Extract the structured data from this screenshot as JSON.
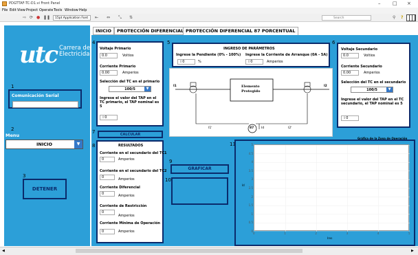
{
  "window": {
    "title": "PDGTTAF-TC-D1.vi Front Panel",
    "controls": [
      "–",
      "□",
      "×"
    ]
  },
  "menu": [
    "File",
    "Edit",
    "View",
    "Project",
    "Operate",
    "Tools",
    "Window",
    "Help"
  ],
  "toolbar": {
    "font": "15pt Application Font",
    "search_placeholder": "Search",
    "help": "?"
  },
  "sidebar": {
    "logo": "utc",
    "brand_line1": "Carrera de",
    "brand_line2": "Electricidad",
    "n1": "1",
    "serial_label": "Comunicación Serial",
    "n2": "2",
    "menu_label": "Menu",
    "menu_value": "INICIO",
    "n3": "3",
    "stop_label": "DETENER"
  },
  "tabs": [
    "INICIO",
    "PROTECCIÓN DIFERENCIAL 87",
    "PROTECCIÓN DIFERENCIAL 87 PORCENTUAL"
  ],
  "primary": {
    "n": "4",
    "voltage_label": "Voltaje Primario",
    "voltage_value": "0.0",
    "voltage_unit": "Voltios",
    "current_label": "Corriente Primario",
    "current_value": "0.00",
    "current_unit": "Amperios",
    "tc_label": "Selección del TC en el primario",
    "tc_value": "100/5",
    "tap_label": "Ingrese el valor del TAP en el TC primario, el TAP nominal es 5",
    "tap_value": "0"
  },
  "params": {
    "n": "5",
    "title": "INGRESO DE PARÁMETROS",
    "slope_label": "Ingrese la Pendiente (0% - 100%)",
    "slope_value": "0",
    "slope_unit": "%",
    "start_label": "Ingrese la Corriente de Arranque (0A - 5A)",
    "start_value": "0",
    "start_unit": "Amperios"
  },
  "diagram": {
    "element_line1": "Elemento",
    "element_line2": "Protegido",
    "i1": "I1",
    "i2": "I2",
    "i1p": "I1'",
    "i2p": "I2'",
    "relay": "87",
    "id": "Id"
  },
  "secondary": {
    "n": "6",
    "voltage_label": "Voltaje Secundario",
    "voltage_value": "0.0",
    "voltage_unit": "Voltios",
    "current_label": "Corriente Secundario",
    "current_value": "0.00",
    "current_unit": "Amperios",
    "tc_label": "Selección del TC en el secundario",
    "tc_value": "100/5",
    "tap_label": "Ingrese el valor del TAP en el TC secundario, el TAP nominal es 5",
    "tap_value": "0"
  },
  "calc": {
    "n": "7",
    "label": "CALCULAR"
  },
  "results": {
    "n": "8",
    "title": "RESULTADOS",
    "items": [
      {
        "label": "Corriente en el secundario del TC1",
        "value": "0",
        "unit": "Amperios"
      },
      {
        "label": "Corriente en el secundario del TC2",
        "value": "0",
        "unit": "Amperios"
      },
      {
        "label": "Corriente Diferencial",
        "value": "0",
        "unit": "Amperios"
      },
      {
        "label": "Corriente de Restricción",
        "value": "0",
        "unit": "Amperios"
      },
      {
        "label": "Corriente Mínima de Operación",
        "value": "0",
        "unit": "Amperios"
      }
    ]
  },
  "graph": {
    "n": "9",
    "label": "GRAFICAR"
  },
  "indicator": {
    "n": "10"
  },
  "chart_n": "11",
  "chart_data": {
    "type": "line",
    "title": "Gráfica de la Zona de Operación",
    "xlabel": "Ires",
    "ylabel": "Id",
    "xlim": [
      0,
      5
    ],
    "ylim": [
      0,
      5
    ],
    "x_ticks": [
      "0",
      "1",
      "2",
      "3",
      "4",
      "5"
    ],
    "y_ticks": [
      "0",
      "0.5",
      "1",
      "1.5",
      "2",
      "2.5",
      "3",
      "3.5",
      "4",
      "4.5",
      "5"
    ],
    "series": []
  }
}
